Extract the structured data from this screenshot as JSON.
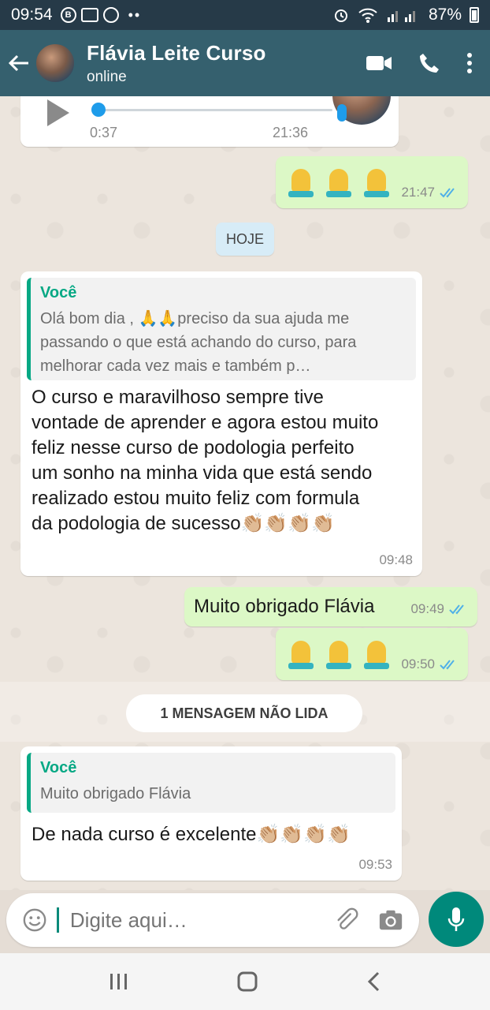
{
  "status_bar": {
    "time": "09:54",
    "battery": "87%"
  },
  "header": {
    "title": "Flávia Leite Curso",
    "status": "online"
  },
  "voice_message": {
    "duration": "0:37",
    "time": "21:36"
  },
  "messages": [
    {
      "type": "out",
      "emoji_text": "🙏🙏🙏",
      "time": "21:47"
    },
    {
      "type": "in",
      "reply_name": "Você",
      "reply_text": "Olá bom dia , 🙏🙏preciso da sua ajuda me passando o que está achando do curso, para melhorar cada vez mais  e  também p…",
      "text_lines": [
        "O curso e maravilhoso sempre tive",
        "vontade de aprender e agora estou muito",
        "feliz nesse curso de podologia perfeito",
        "um sonho na minha vida que está sendo",
        "realizado estou muito feliz com formula",
        "da podologia de sucesso👏🏼👏🏼👏🏼👏🏼"
      ],
      "time": "09:48"
    },
    {
      "type": "out",
      "text": "Muito obrigado Flávia",
      "time": "09:49"
    },
    {
      "type": "out",
      "emoji_text": "🙏🙏🙏",
      "time": "09:50"
    },
    {
      "type": "in",
      "reply_name": "Você",
      "reply_text": "Muito obrigado Flávia",
      "text": "De nada curso é excelente👏🏼👏🏼👏🏼👏🏼",
      "time": "09:53"
    }
  ],
  "date_chip": "HOJE",
  "unread_banner": "1 MENSAGEM NÃO LIDA",
  "composer": {
    "placeholder": "Digite aqui…"
  },
  "icons": [
    "back-arrow-icon",
    "video-call-icon",
    "phone-icon",
    "more-vert-icon",
    "emoji-icon",
    "attach-icon",
    "camera-icon",
    "mic-icon"
  ]
}
